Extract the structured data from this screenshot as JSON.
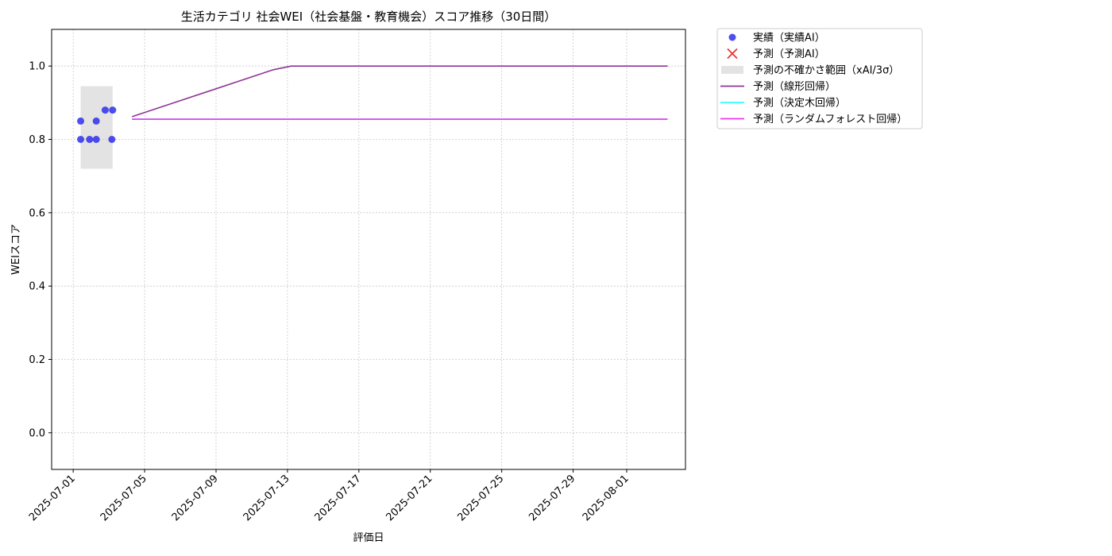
{
  "chart_data": {
    "type": "line",
    "title": "生活カテゴリ 社会WEI（社会基盤・教育機会）スコア推移（30日間）",
    "xlabel": "評価日",
    "ylabel": "WEIスコア",
    "x_type": "date",
    "xlim": [
      "2025-06-29T19:00",
      "2025-08-04T07:00"
    ],
    "ylim": [
      -0.1,
      1.1
    ],
    "y_ticks": [
      0.0,
      0.2,
      0.4,
      0.6,
      0.8,
      1.0
    ],
    "y_tick_labels": [
      "0.0",
      "0.2",
      "0.4",
      "0.6",
      "0.8",
      "1.0"
    ],
    "x_ticks": [
      "2025-07-01",
      "2025-07-05",
      "2025-07-09",
      "2025-07-13",
      "2025-07-17",
      "2025-07-21",
      "2025-07-25",
      "2025-07-29",
      "2025-08-01"
    ],
    "grid": true,
    "legend_position": "outside-top-right",
    "uncertainty_band": {
      "name": "予測の不確かさ範囲（xAI/3σ）",
      "x_range": [
        "2025-07-01T10:00",
        "2025-07-03T05:00"
      ],
      "y_range": [
        0.72,
        0.945
      ],
      "color": "#c8c8c8"
    },
    "series": [
      {
        "name": "実績（実績AI）",
        "kind": "scatter",
        "marker": "circle",
        "color": "#2222ee",
        "points": [
          {
            "x": "2025-07-01T10:00",
            "y": 0.85
          },
          {
            "x": "2025-07-01T10:00",
            "y": 0.8
          },
          {
            "x": "2025-07-01T22:00",
            "y": 0.8
          },
          {
            "x": "2025-07-02T07:00",
            "y": 0.85
          },
          {
            "x": "2025-07-02T07:00",
            "y": 0.8
          },
          {
            "x": "2025-07-02T19:00",
            "y": 0.88
          },
          {
            "x": "2025-07-03T04:00",
            "y": 0.8
          },
          {
            "x": "2025-07-03T05:00",
            "y": 0.88
          }
        ]
      },
      {
        "name": "予測（予測AI）",
        "kind": "scatter",
        "marker": "x",
        "color": "#ee3333",
        "points": []
      },
      {
        "name": "予測（線形回帰）",
        "kind": "line",
        "color": "#8e3596",
        "points": [
          {
            "x": "2025-07-04T07:00",
            "y": 0.862
          },
          {
            "x": "2025-07-12T05:00",
            "y": 0.99
          },
          {
            "x": "2025-07-13T05:00",
            "y": 1.0
          },
          {
            "x": "2025-08-03T07:00",
            "y": 1.0
          }
        ]
      },
      {
        "name": "予測（決定木回帰）",
        "kind": "line",
        "color": "#33ffff",
        "points": [
          {
            "x": "2025-07-04T07:00",
            "y": 0.855
          },
          {
            "x": "2025-08-03T07:00",
            "y": 0.855
          }
        ]
      },
      {
        "name": "予測（ランダムフォレスト回帰）",
        "kind": "line",
        "color": "#ee33ee",
        "points": [
          {
            "x": "2025-07-04T07:00",
            "y": 0.855
          },
          {
            "x": "2025-08-03T07:00",
            "y": 0.855
          }
        ]
      }
    ],
    "legend_order": [
      "実績（実績AI）",
      "予測（予測AI）",
      "予測の不確かさ範囲（xAI/3σ）",
      "予測（線形回帰）",
      "予測（決定木回帰）",
      "予測（ランダムフォレスト回帰）"
    ]
  }
}
